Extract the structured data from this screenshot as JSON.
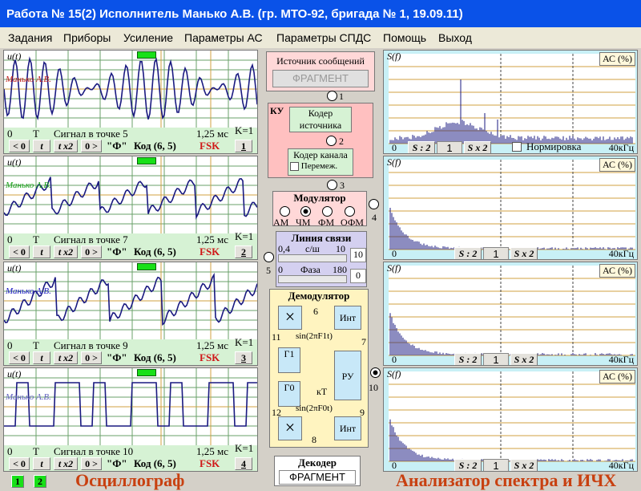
{
  "title": "Работа № 15(2)  Исполнитель Манько А.В. (гр. МТО-92, бригада № 1, 19.09.11)",
  "menu": [
    "Задания",
    "Приборы",
    "Усиление",
    "Параметры АС",
    "Параметры СПДС",
    "Помощь",
    "Выход"
  ],
  "oscilloscopes": [
    {
      "ylabel": "u(t)",
      "signature": "Манько А.В.",
      "zero": "0",
      "t": "T",
      "signal": "Сигнал в точке 5",
      "time": "1,25 мс",
      "k": "K=1",
      "btn_lt": "< 0",
      "btn_t": "t",
      "btn_x2": "t x2",
      "btn_gt": "0 >",
      "phi": "\"Ф\"",
      "code": "Код (6, 5)",
      "fsk": "FSK",
      "num": "1"
    },
    {
      "ylabel": "u(t)",
      "signature": "Манько А.В.",
      "zero": "0",
      "t": "T",
      "signal": "Сигнал в точке 7",
      "time": "1,25 мс",
      "k": "K=1",
      "btn_lt": "< 0",
      "btn_t": "t",
      "btn_x2": "t x2",
      "btn_gt": "0 >",
      "phi": "\"Ф\"",
      "code": "Код (6, 5)",
      "fsk": "FSK",
      "num": "2"
    },
    {
      "ylabel": "u(t)",
      "signature": "Манько А.В.",
      "zero": "0",
      "t": "T",
      "signal": "Сигнал в точке 9",
      "time": "1,25 мс",
      "k": "K=1",
      "btn_lt": "< 0",
      "btn_t": "t",
      "btn_x2": "t x2",
      "btn_gt": "0 >",
      "phi": "\"Ф\"",
      "code": "Код (6, 5)",
      "fsk": "FSK",
      "num": "3"
    },
    {
      "ylabel": "u(t)",
      "signature": "Манько А.В.",
      "zero": "0",
      "t": "T",
      "signal": "Сигнал в точке 10",
      "time": "1,25 мс",
      "k": "K=1",
      "btn_lt": "< 0",
      "btn_t": "t",
      "btn_x2": "t x2",
      "btn_gt": "0 >",
      "phi": "\"Ф\"",
      "code": "Код (6, 5)",
      "fsk": "FSK",
      "num": "4"
    }
  ],
  "spectra": [
    {
      "ylabel": "S(f)",
      "ac": "АС (%)",
      "zero": "0",
      "freq": "40кГц",
      "div": "S : 2",
      "val": "1",
      "mul": "S x 2",
      "norm": "Нормировка"
    },
    {
      "ylabel": "S(f)",
      "ac": "АС (%)",
      "zero": "0",
      "freq": "40кГц",
      "div": "S : 2",
      "val": "1",
      "mul": "S x 2"
    },
    {
      "ylabel": "S(f)",
      "ac": "АС (%)",
      "zero": "0",
      "freq": "40кГц",
      "div": "S : 2",
      "val": "1",
      "mul": "S x 2"
    },
    {
      "ylabel": "S(f)",
      "ac": "АС (%)",
      "zero": "0",
      "freq": "40кГц",
      "div": "S : 2",
      "val": "1",
      "mul": "S x 2"
    }
  ],
  "scheme": {
    "source_label": "Источник сообщений",
    "source_value": "ФРАГМЕНТ",
    "ku": "КУ",
    "coder_source": "Кодер источника",
    "coder_channel": "Кодер канала",
    "interleave": "Перемеж.",
    "modulator": "Модулятор",
    "mods": [
      "АМ",
      "ЧМ",
      "ФМ",
      "ОФМ"
    ],
    "line": "Линия связи",
    "snr_min": "0,4",
    "snr_unit": "с/ш",
    "snr_max": "10",
    "snr_value": "10",
    "phase_min": "0",
    "phase_label": "Фаза",
    "phase_max": "180",
    "phase_value": "0",
    "demod": "Демодулятор",
    "int1": "Инт",
    "int2": "Инт",
    "sin1": "sin(2πF1t)",
    "sin0": "sin(2πF0t)",
    "g1": "Г1",
    "g0": "Г0",
    "ru": "РУ",
    "kt": "кТ",
    "decoder": "Декодер",
    "decoder_value": "ФРАГМЕНТ",
    "points": [
      "1",
      "2",
      "3",
      "4",
      "5",
      "6",
      "7",
      "8",
      "9",
      "10",
      "11",
      "12"
    ]
  },
  "footer": {
    "osc": "Осциллограф",
    "spec": "Анализатор спектра и ИЧХ",
    "b1": "1",
    "b2": "2"
  }
}
